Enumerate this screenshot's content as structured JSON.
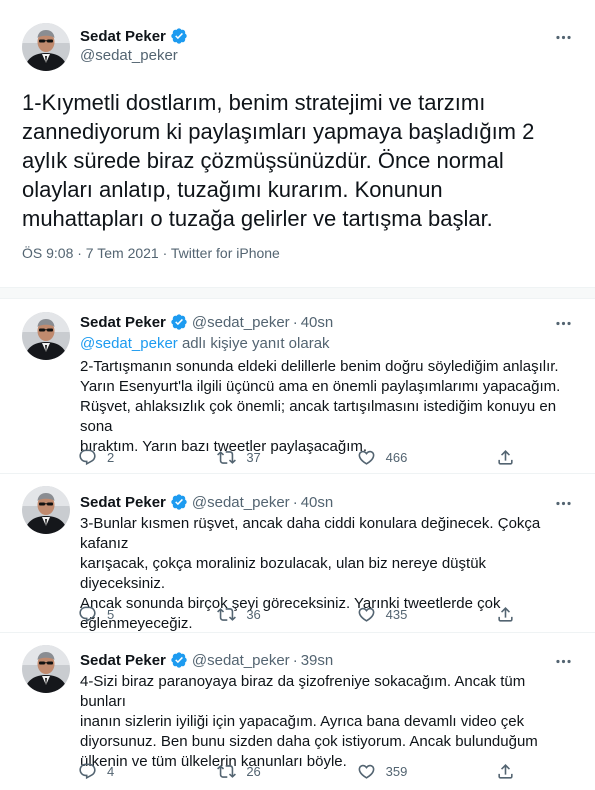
{
  "main_tweet": {
    "author_name": "Sedat Peker",
    "handle": "@sedat_peker",
    "text": "1-Kıymetli dostlarım, benim stratejimi ve tarzımı\nzannediyorum ki paylaşımları yapmaya başladığım 2\naylık sürede biraz çözmüşsünüzdür. Önce normal\nolayları anlatıp, tuzağımı kurarım. Konunun\nmuhattapları o tuzağa gelirler ve tartışma başlar.",
    "meta": "ÖS 9:08 · 7 Tem 2021 · Twitter for iPhone"
  },
  "replies": [
    {
      "author_name": "Sedat Peker",
      "handle": "@sedat_peker",
      "dot": "·",
      "time": "40sn",
      "replying_mention": "@sedat_peker",
      "replying_suffix": " adlı kişiye yanıt olarak",
      "text": "2-Tartışmanın sonunda eldeki delillerle benim doğru söylediğim anlaşılır.\nYarın Esenyurt'la ilgili üçüncü ama en önemli paylaşımlarımı yapacağım.\nRüşvet, ahlaksızlık çok önemli; ancak tartışılmasını istediğim konuyu en sona\nbıraktım. Yarın bazı tweetler paylaşacağım.",
      "reply_count": "2",
      "retweet_count": "37",
      "like_count": "466"
    },
    {
      "author_name": "Sedat Peker",
      "handle": "@sedat_peker",
      "dot": "·",
      "time": "40sn",
      "text": "3-Bunlar kısmen rüşvet, ancak daha ciddi konulara değinecek. Çokça kafanız\nkarışacak, çokça moraliniz bozulacak, ulan biz nereye düştük diyeceksiniz.\nAncak sonunda birçok şeyi göreceksiniz. Yarınki tweetlerde çok\neğlenmeyeceğiz.",
      "reply_count": "5",
      "retweet_count": "36",
      "like_count": "435"
    },
    {
      "author_name": "Sedat Peker",
      "handle": "@sedat_peker",
      "dot": "·",
      "time": "39sn",
      "text": "4-Sizi biraz paranoyaya biraz da şizofreniye sokacağım. Ancak tüm bunları\ninanın sizlerin iyiliği için yapacağım. Ayrıca bana devamlı video çek\ndiyorsunuz. Ben bunu sizden daha çok istiyorum. Ancak bulunduğum\nülkenin ve tüm ülkelerin kanunları böyle.",
      "reply_count": "4",
      "retweet_count": "26",
      "like_count": "359"
    }
  ],
  "colors": {
    "text_primary": "#0f1419",
    "text_secondary": "#536471",
    "accent": "#1d9bf0",
    "border": "#eff3f4"
  },
  "icons": [
    "avatar",
    "verified-badge-icon",
    "more-options-icon",
    "reply-icon",
    "retweet-icon",
    "like-icon",
    "share-icon"
  ]
}
